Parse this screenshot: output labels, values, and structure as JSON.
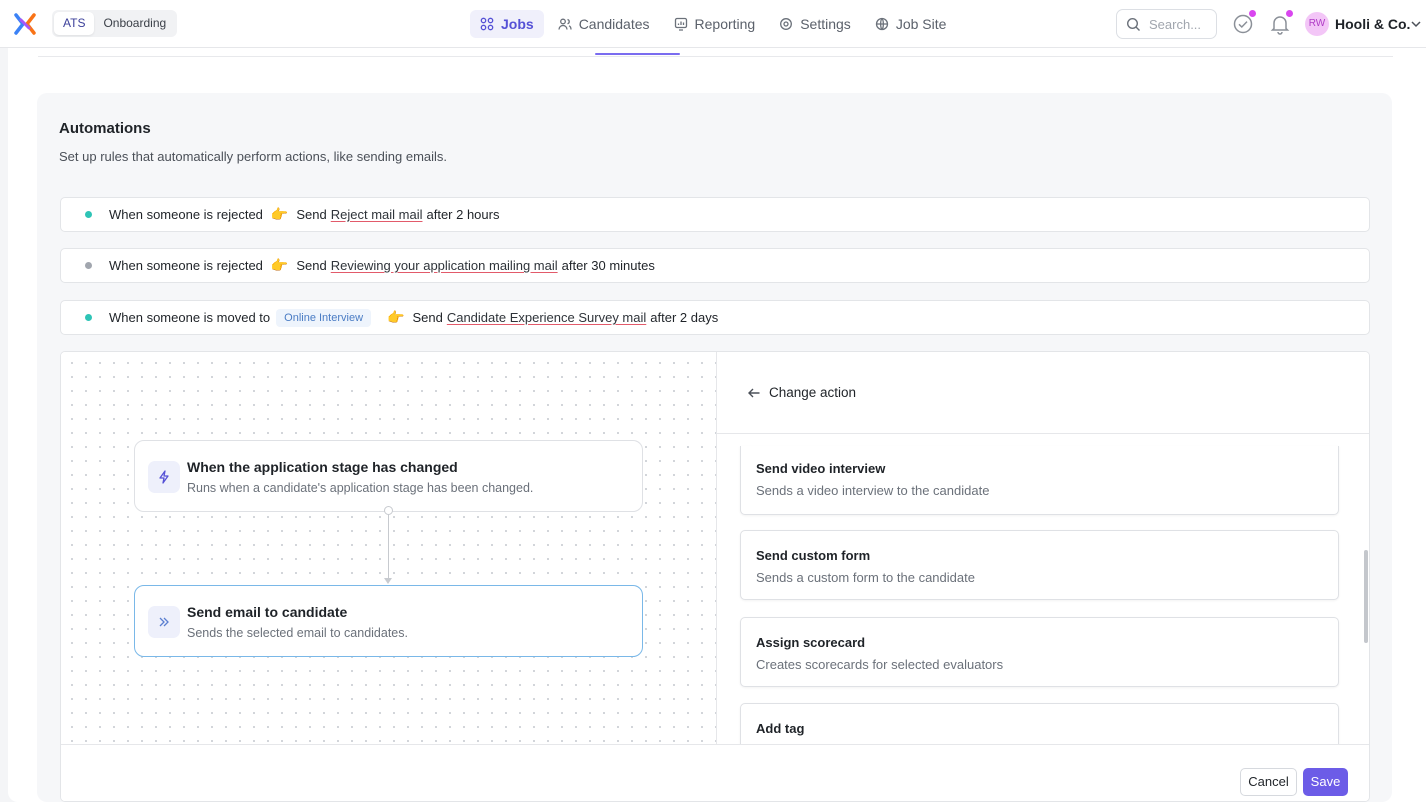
{
  "topbar": {
    "apps": [
      {
        "label": "ATS",
        "active": true
      },
      {
        "label": "Onboarding",
        "active": false
      }
    ],
    "nav": [
      {
        "label": "Jobs",
        "icon": "grid-icon",
        "active": true
      },
      {
        "label": "Candidates",
        "icon": "users-icon",
        "active": false
      },
      {
        "label": "Reporting",
        "icon": "chart-icon",
        "active": false
      },
      {
        "label": "Settings",
        "icon": "gear-icon",
        "active": false
      },
      {
        "label": "Job Site",
        "icon": "globe-icon",
        "active": false
      }
    ],
    "search_placeholder": "Search...",
    "user_initials": "RW",
    "company": "Hooli & Co."
  },
  "automations": {
    "title": "Automations",
    "subtitle": "Set up rules that automatically perform actions, like sending emails.",
    "rules": [
      {
        "status_color": "#2ec4b6",
        "prefix": "When someone is rejected",
        "stage_tag": "",
        "send": "Send",
        "mail": "Reject mail mail",
        "delay": "after 2 hours"
      },
      {
        "status_color": "#a1a6ae",
        "prefix": "When someone is rejected",
        "stage_tag": "",
        "send": "Send",
        "mail": "Reviewing your application mailing mail",
        "delay": "after 30 minutes"
      },
      {
        "status_color": "#2ec4b6",
        "prefix": "When someone is moved to",
        "stage_tag": "Online Interview",
        "send": "Send",
        "mail": "Candidate Experience Survey mail",
        "delay": "after 2 days"
      }
    ]
  },
  "flow": {
    "trigger": {
      "title": "When the application stage has changed",
      "desc": "Runs when a candidate's application stage has been changed."
    },
    "action": {
      "title": "Send email to candidate",
      "desc": "Sends the selected email to candidates."
    }
  },
  "panel": {
    "back_label": "Change action",
    "actions": [
      {
        "title": "Send video interview",
        "desc": "Sends a video interview to the candidate"
      },
      {
        "title": "Send custom form",
        "desc": "Sends a custom form to the candidate"
      },
      {
        "title": "Assign scorecard",
        "desc": "Creates scorecards for selected evaluators"
      },
      {
        "title": "Add tag",
        "desc": ""
      }
    ]
  },
  "footer": {
    "cancel_label": "Cancel",
    "save_label": "Save"
  },
  "colors": {
    "accent": "#6c5ce7",
    "nav_active": "#5551d6",
    "selected_node_border": "#7ab8e8"
  }
}
